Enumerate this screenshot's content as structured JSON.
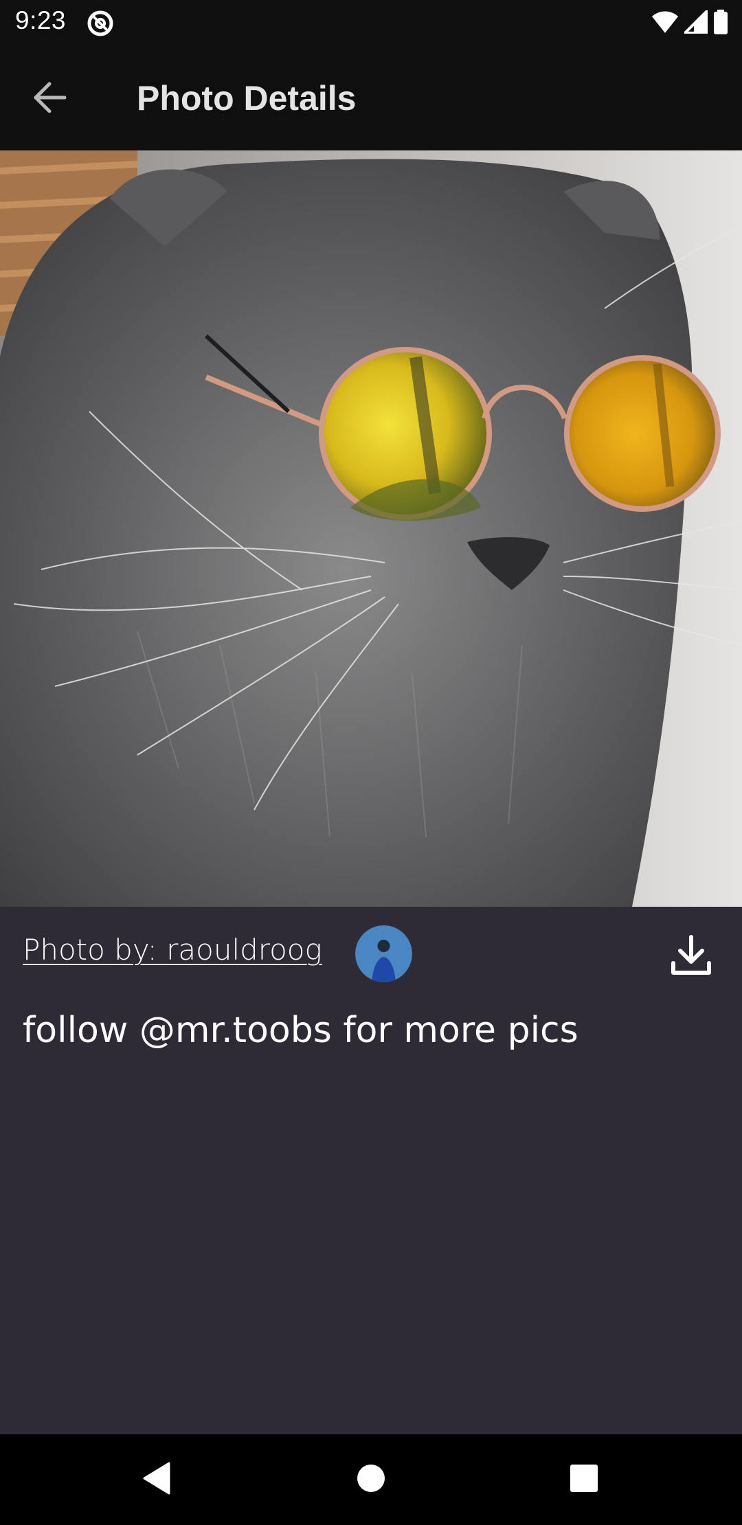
{
  "status_bar": {
    "time": "9:23"
  },
  "app_bar": {
    "title": "Photo Details",
    "back_icon": "arrow-back-icon"
  },
  "photo": {
    "subject": "gray cat wearing round yellow sunglasses"
  },
  "details": {
    "credit": "Photo by: raouldroog",
    "description": "follow @mr.toobs for more pics",
    "download_icon": "download-icon"
  },
  "nav_bar": {
    "back_icon": "nav-back-icon",
    "home_icon": "nav-home-icon",
    "recents_icon": "nav-recents-icon"
  },
  "colors": {
    "background": "#2e2b36",
    "bar": "#0f0f10",
    "text": "#ffffff"
  }
}
